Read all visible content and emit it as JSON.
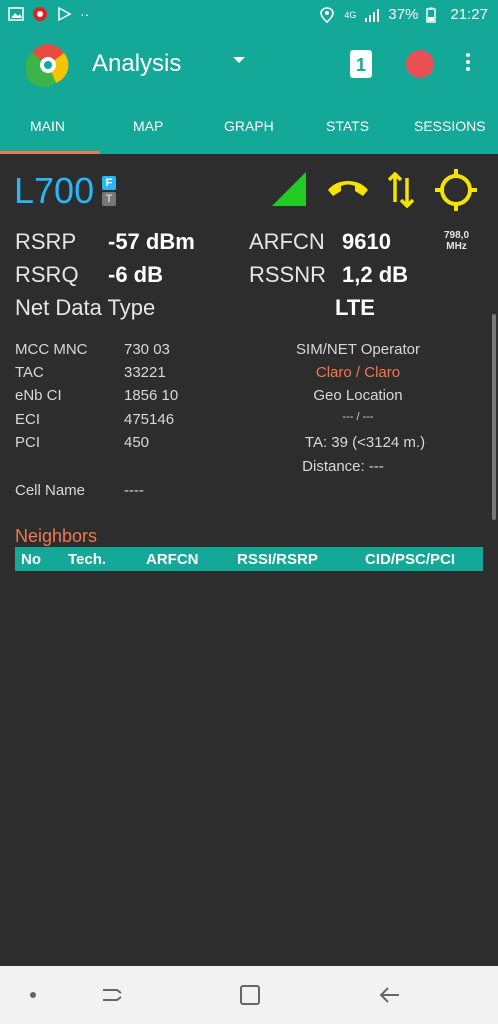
{
  "status_bar": {
    "network": "4G",
    "battery": "37%",
    "time": "21:27"
  },
  "app_bar": {
    "title": "Analysis",
    "sim_number": "1"
  },
  "tabs": [
    {
      "label": "MAIN"
    },
    {
      "label": "MAP"
    },
    {
      "label": "GRAPH"
    },
    {
      "label": "STATS"
    },
    {
      "label": "SESSIONS"
    }
  ],
  "cell": {
    "technology": "L700",
    "badge_f": "F",
    "badge_t": "T",
    "rsrp_label": "RSRP",
    "rsrp_value": "-57 dBm",
    "rsrq_label": "RSRQ",
    "rsrq_value": "-6 dB",
    "arfcn_label": "ARFCN",
    "arfcn_value": "9610",
    "freq_value": "798,0",
    "freq_unit": "MHz",
    "rssnr_label": "RSSNR",
    "rssnr_value": "1,2 dB",
    "net_data_type_label": "Net Data Type",
    "net_data_type_value": "LTE"
  },
  "info": {
    "mcc_mnc_label": "MCC MNC",
    "mcc_mnc_value": "730 03",
    "tac_label": "TAC",
    "tac_value": "33221",
    "enb_ci_label": "eNb CI",
    "enb_ci_value": "1856 10",
    "eci_label": "ECI",
    "eci_value": "475146",
    "pci_label": "PCI",
    "pci_value": "450",
    "cell_name_label": "Cell Name",
    "cell_name_value": "----",
    "sim_net_operator_label": "SIM/NET Operator",
    "operator_value": "Claro / Claro",
    "geo_location_label": "Geo Location",
    "geo_location_value": "--- / ---",
    "ta_value": "TA: 39 (<3124 m.)",
    "distance_value": "Distance: ---"
  },
  "neighbors": {
    "title": "Neighbors",
    "columns": [
      "No",
      "Tech.",
      "ARFCN",
      "RSSI/RSRP",
      "CID/PSC/PCI"
    ]
  },
  "colors": {
    "accent": "#14a898",
    "tech": "#29b6f6",
    "highlight": "#f07850",
    "signal": "#22cc22",
    "yellow": "#f5e400"
  }
}
